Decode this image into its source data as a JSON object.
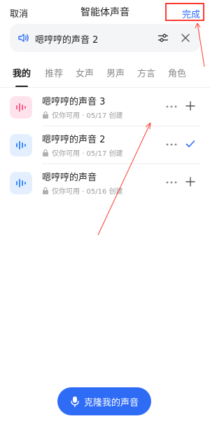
{
  "header": {
    "cancel_label": "取消",
    "title": "智能体声音",
    "done_label": "完成"
  },
  "current_voice": {
    "name": "嗯哼哼的声音 2",
    "icons": [
      "speaker-icon",
      "adjust-icon",
      "close-icon"
    ]
  },
  "tabs": [
    {
      "label": "我的",
      "active": true
    },
    {
      "label": "推荐",
      "active": false
    },
    {
      "label": "女声",
      "active": false
    },
    {
      "label": "男声",
      "active": false
    },
    {
      "label": "方言",
      "active": false
    },
    {
      "label": "角色",
      "active": false
    }
  ],
  "voices": [
    {
      "name": "嗯哼哼的声音 3",
      "meta": "仅你可用 · 05/17 创建",
      "avatar_color": "#ff5c8a",
      "avatar_bg": "#ffe3ec",
      "selected": false
    },
    {
      "name": "嗯哼哼的声音 2",
      "meta": "仅你可用 · 05/17 创建",
      "avatar_color": "#3d8bff",
      "avatar_bg": "#e3efff",
      "selected": true
    },
    {
      "name": "嗯哼哼的声音",
      "meta": "仅你可用 · 05/16 创建",
      "avatar_color": "#3d8bff",
      "avatar_bg": "#e3efff",
      "selected": false
    }
  ],
  "clone_button": {
    "label": "克隆我的声音"
  },
  "colors": {
    "accent": "#2f6cf6",
    "annotation": "#ff3b30"
  }
}
